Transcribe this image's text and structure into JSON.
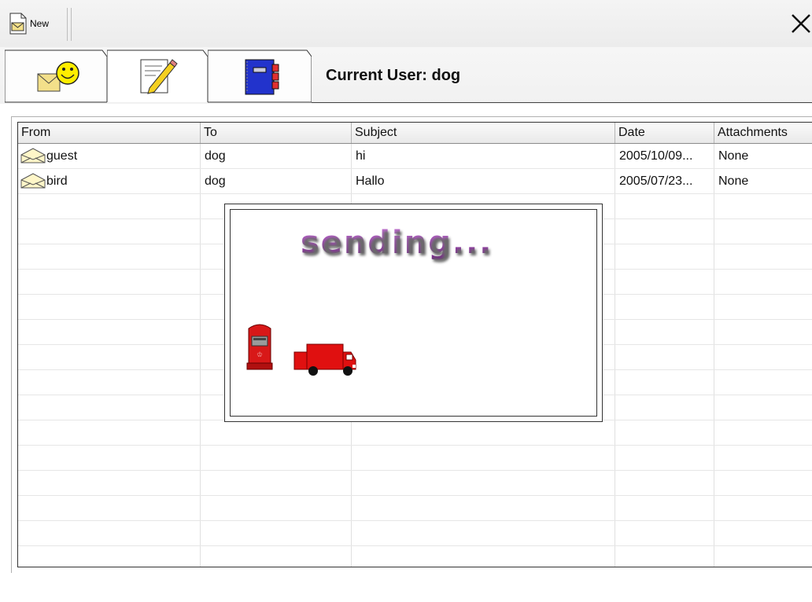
{
  "toolbar": {
    "new_label": "New"
  },
  "header": {
    "current_user": "Current User: dog"
  },
  "tabs": [
    {
      "name": "inbox",
      "icon": "envelope-smiley-icon"
    },
    {
      "name": "compose",
      "icon": "notepad-pencil-icon"
    },
    {
      "name": "address-book",
      "icon": "address-book-icon"
    }
  ],
  "table": {
    "columns": [
      "From",
      "To",
      "Subject",
      "Date",
      "Attachments"
    ],
    "rows": [
      {
        "from": "guest",
        "to": "dog",
        "subject": "hi",
        "date": "2005/10/09...",
        "attachments": "None"
      },
      {
        "from": "bird",
        "to": "dog",
        "subject": "Hallo",
        "date": "2005/07/23...",
        "attachments": "None"
      }
    ]
  },
  "dialog": {
    "text": "sending..."
  },
  "colors": {
    "accent_purple": "#8b2a9a",
    "truck_red": "#e01010",
    "postbox_red": "#d81818",
    "book_blue": "#2233cc"
  }
}
